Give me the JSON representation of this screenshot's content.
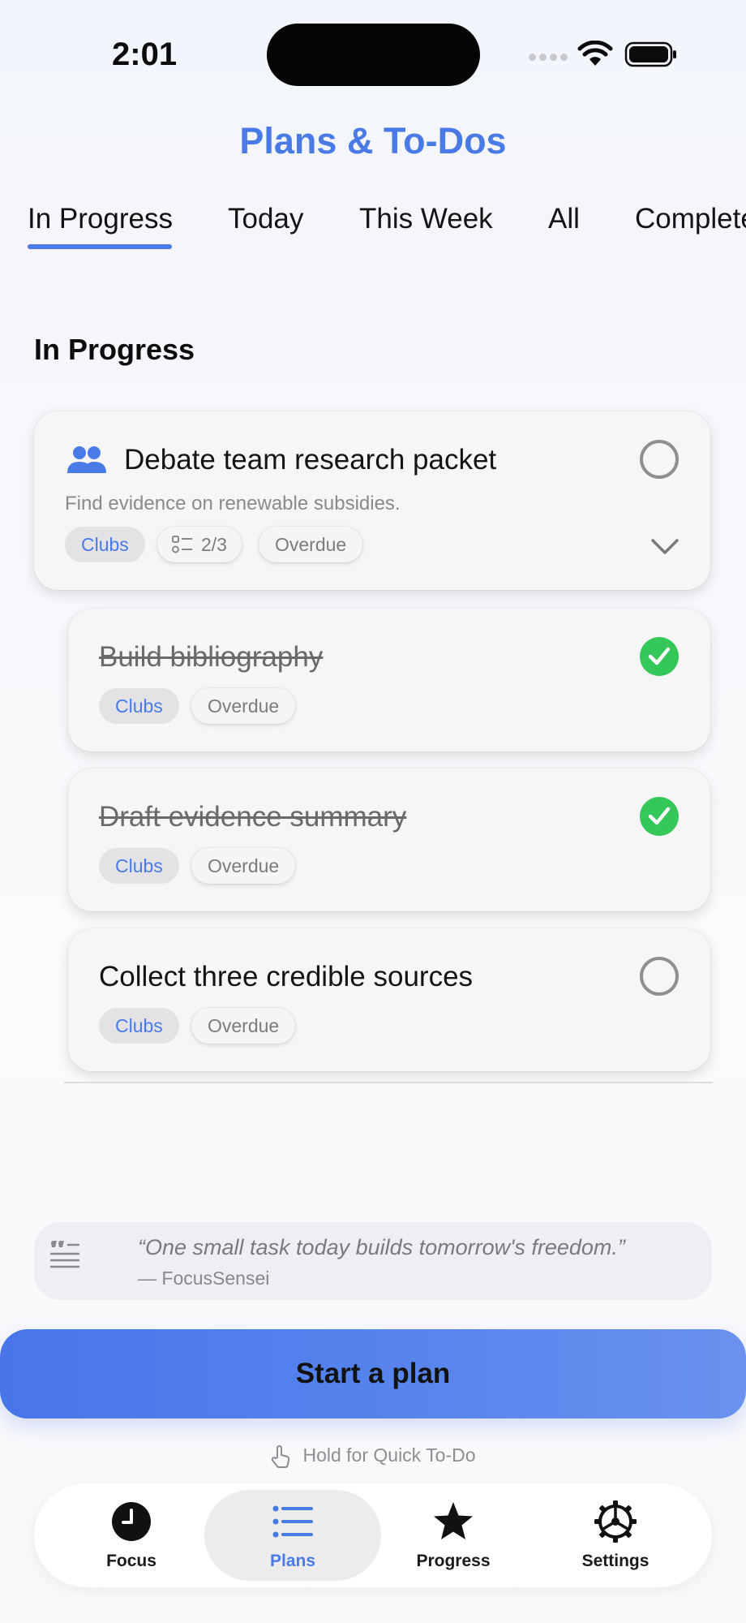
{
  "status_bar": {
    "time": "2:01"
  },
  "app_title": "Plans & To-Dos",
  "tabs": [
    {
      "label": "In Progress",
      "active": true
    },
    {
      "label": "Today"
    },
    {
      "label": "This Week"
    },
    {
      "label": "All"
    },
    {
      "label": "Completed"
    }
  ],
  "section_title": "In Progress",
  "plan": {
    "title": "Debate team research packet",
    "description": "Find evidence on renewable subsidies.",
    "category": "Clubs",
    "steps_progress": "2/3",
    "status": "Overdue",
    "icon": "people-icon",
    "completed": false
  },
  "subtasks": [
    {
      "title": "Build bibliography",
      "category": "Clubs",
      "status": "Overdue",
      "completed": true
    },
    {
      "title": "Draft evidence summary",
      "category": "Clubs",
      "status": "Overdue",
      "completed": true
    },
    {
      "title": "Collect three credible sources",
      "category": "Clubs",
      "status": "Overdue",
      "completed": false
    }
  ],
  "quote": {
    "text": "“One small task today builds tomorrow's freedom.”",
    "author": "— FocusSensei"
  },
  "start_button": "Start a plan",
  "hold_hint": "Hold for Quick To-Do",
  "bottom_nav": [
    {
      "label": "Focus",
      "icon": "clock-icon"
    },
    {
      "label": "Plans",
      "icon": "list-icon",
      "selected": true
    },
    {
      "label": "Progress",
      "icon": "star-icon"
    },
    {
      "label": "Settings",
      "icon": "gear-icon"
    }
  ],
  "colors": {
    "accent": "#4a7ae6",
    "success": "#34c759"
  }
}
